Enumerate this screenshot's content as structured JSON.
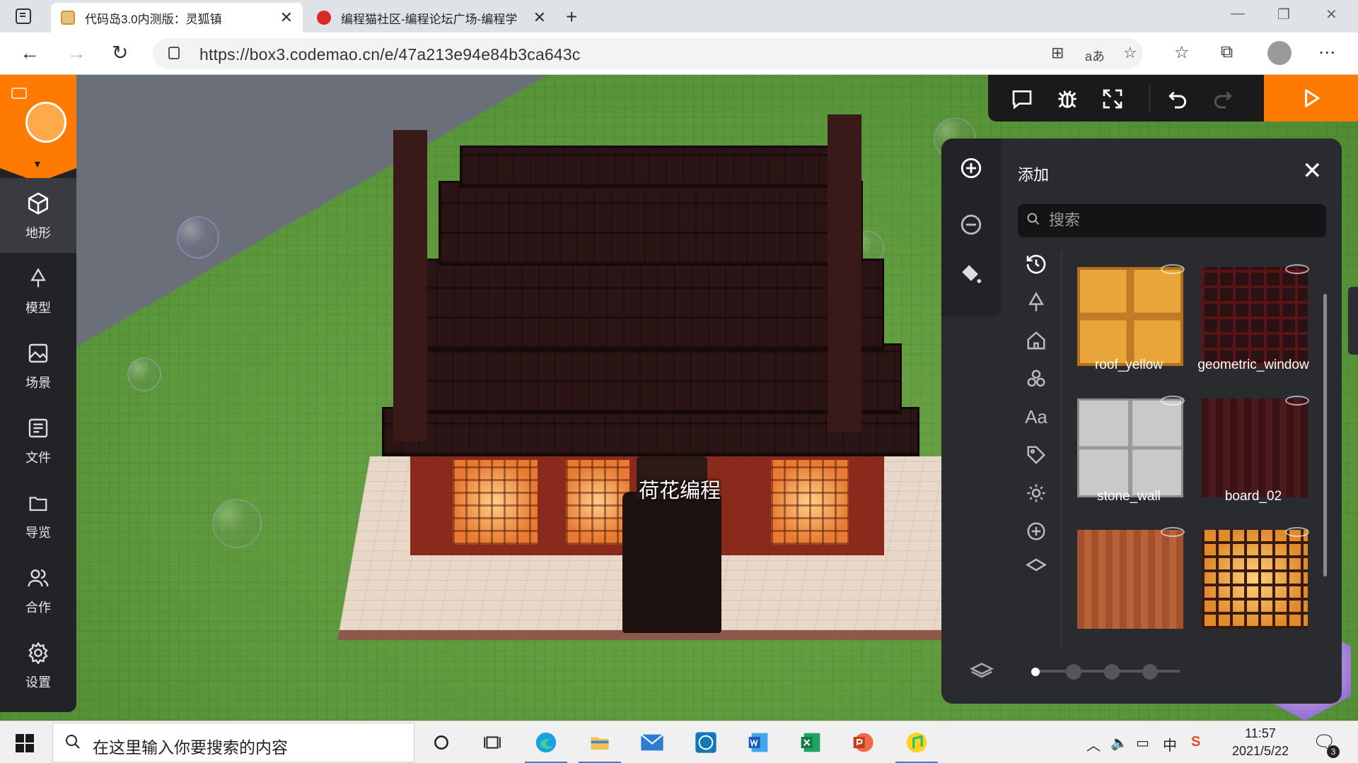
{
  "browser": {
    "tabs": [
      {
        "title": "代码岛3.0内测版：灵狐镇",
        "active": true
      },
      {
        "title": "编程猫社区-编程论坛广场-编程学",
        "active": false
      }
    ],
    "url": "https://box3.codemao.cn/e/47a213e94e84b3ca643c"
  },
  "sidebar": {
    "items": [
      {
        "label": "地形",
        "icon": "cube-icon",
        "active": true
      },
      {
        "label": "模型",
        "icon": "tree-icon",
        "active": false
      },
      {
        "label": "场景",
        "icon": "image-icon",
        "active": false
      },
      {
        "label": "文件",
        "icon": "file-icon",
        "active": false
      },
      {
        "label": "导览",
        "icon": "folder-icon",
        "active": false
      },
      {
        "label": "合作",
        "icon": "users-icon",
        "active": false
      },
      {
        "label": "设置",
        "icon": "gear-icon",
        "active": false
      }
    ]
  },
  "scene": {
    "player_name": "荷花编程"
  },
  "panel": {
    "title": "添加",
    "search_placeholder": "搜索",
    "items": [
      {
        "name": "roof_yellow"
      },
      {
        "name": "geometric_window"
      },
      {
        "name": "stone_wall"
      },
      {
        "name": "board_02"
      },
      {
        "name": ""
      },
      {
        "name": ""
      }
    ],
    "categories": [
      "history-icon",
      "tree-icon",
      "house-icon",
      "shapes-icon",
      "text-icon",
      "tag-icon",
      "sun-icon",
      "plus-icon",
      "layers-icon"
    ],
    "brush_size_level": 0
  },
  "taskbar": {
    "search_placeholder": "在这里输入你要搜索的内容",
    "time": "11:57",
    "date": "2021/5/22",
    "ime": "中",
    "notification_count": "3"
  },
  "colors": {
    "accent": "#ff7a00",
    "sidebar_bg": "#222327",
    "panel_bg": "#2a2b2f"
  }
}
